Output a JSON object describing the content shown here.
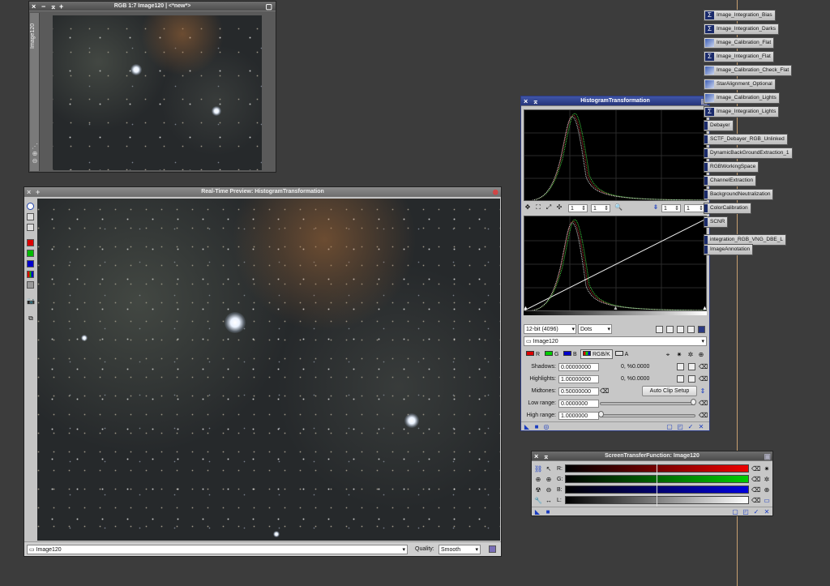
{
  "windows": {
    "image120": {
      "title": "RGB 1:7 Image120 | <*new*>",
      "side_tab": "Image120"
    },
    "preview": {
      "title": "Real-Time Preview: HistogramTransformation",
      "view_select": "Image120",
      "quality_label": "Quality:",
      "quality_value": "Smooth"
    },
    "histogram": {
      "title": "HistogramTransformation",
      "zoom_h1": "1",
      "zoom_v1": "1",
      "zoom_h2": "1",
      "zoom_v2": "1",
      "bit_depth": "12-bit (4096)",
      "graph_style": "Dots",
      "view": "Image120",
      "channels": [
        "R",
        "G",
        "B",
        "RGB/K",
        "A"
      ],
      "shadows_label": "Shadows:",
      "shadows_value": "0.00000000",
      "shadows_clip": "0, %0.0000",
      "highlights_label": "Highlights:",
      "highlights_value": "1.00000000",
      "highlights_clip": "0, %0.0000",
      "midtones_label": "Midtones:",
      "midtones_value": "0.50000000",
      "auto_clip_button": "Auto Clip Setup",
      "low_range_label": "Low range:",
      "low_range_value": "0.0000000",
      "high_range_label": "High range:",
      "high_range_value": "1.0000000"
    },
    "stf": {
      "title": "ScreenTransferFunction: Image120",
      "channels": [
        "R:",
        "G:",
        "B:",
        "L:"
      ]
    }
  },
  "process_icons": [
    {
      "label": "Image_Integration_Bias",
      "icon": "sigma"
    },
    {
      "label": "Image_Integration_Darks",
      "icon": "sigma"
    },
    {
      "label": "Image_Calibration_Flat",
      "icon": "image"
    },
    {
      "label": "Image_Integration_Flat",
      "icon": "sigma"
    },
    {
      "label": "Image_Calibration_Check_Flat",
      "icon": "image"
    },
    {
      "label": "StarAlignment_Optional",
      "icon": "image"
    },
    {
      "label": "Image_Calibration_Lights",
      "icon": "image"
    },
    {
      "label": "Image_Integration_Lights",
      "icon": "sigma"
    },
    {
      "label": "Debayer",
      "icon": "tri"
    },
    {
      "label": "SCTF_Debayer_RGB_Unlinked",
      "icon": "tri"
    },
    {
      "label": "DynamicBackGroundExtraction_1",
      "icon": "tri"
    },
    {
      "label": "RGBWorkingSpace",
      "icon": "tri"
    },
    {
      "label": "ChannelExtraction",
      "icon": "tri"
    },
    {
      "label": "BackgroundNeutralization",
      "icon": "tri"
    },
    {
      "label": "ColorCalibration",
      "icon": "tri"
    },
    {
      "label": "SCNR",
      "icon": "tri"
    },
    {
      "label": "integration_RGB_VNG_DBE_L",
      "icon": "tri"
    },
    {
      "label": "ImageAnnotation",
      "icon": "tri"
    }
  ],
  "colors": {
    "desktop": "#3c3c3c",
    "titlebar_active": "#2b3a82",
    "histogram_bg": "#000000",
    "red": "#e00000",
    "green": "#00cc00",
    "blue": "#0000dd"
  }
}
